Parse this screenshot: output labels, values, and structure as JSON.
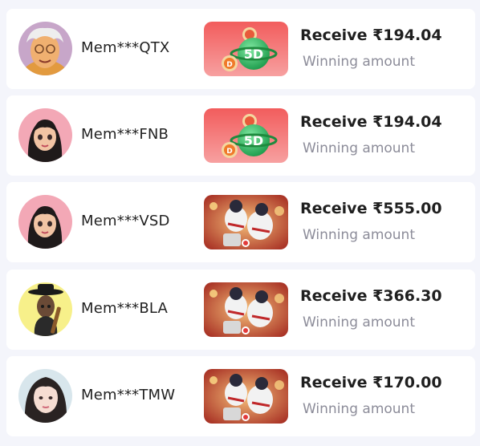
{
  "winners": [
    {
      "user": "Mem***QTX",
      "game": "5d-lottery",
      "receive": "Receive ₹194.04",
      "label": "Winning amount"
    },
    {
      "user": "Mem***FNB",
      "game": "5d-lottery",
      "receive": "Receive ₹194.04",
      "label": "Winning amount"
    },
    {
      "user": "Mem***VSD",
      "game": "baseball-slot",
      "receive": "Receive ₹555.00",
      "label": "Winning amount"
    },
    {
      "user": "Mem***BLA",
      "game": "baseball-slot",
      "receive": "Receive ₹366.30",
      "label": "Winning amount"
    },
    {
      "user": "Mem***TMW",
      "game": "baseball-slot",
      "receive": "Receive ₹170.00",
      "label": "Winning amount"
    }
  ],
  "colors": {
    "page_bg": "#f4f5fb",
    "card_bg": "#ffffff",
    "lottery_bg": "#f26b6b",
    "text_dark": "#1f1f1f",
    "text_muted": "#8c8c99"
  }
}
